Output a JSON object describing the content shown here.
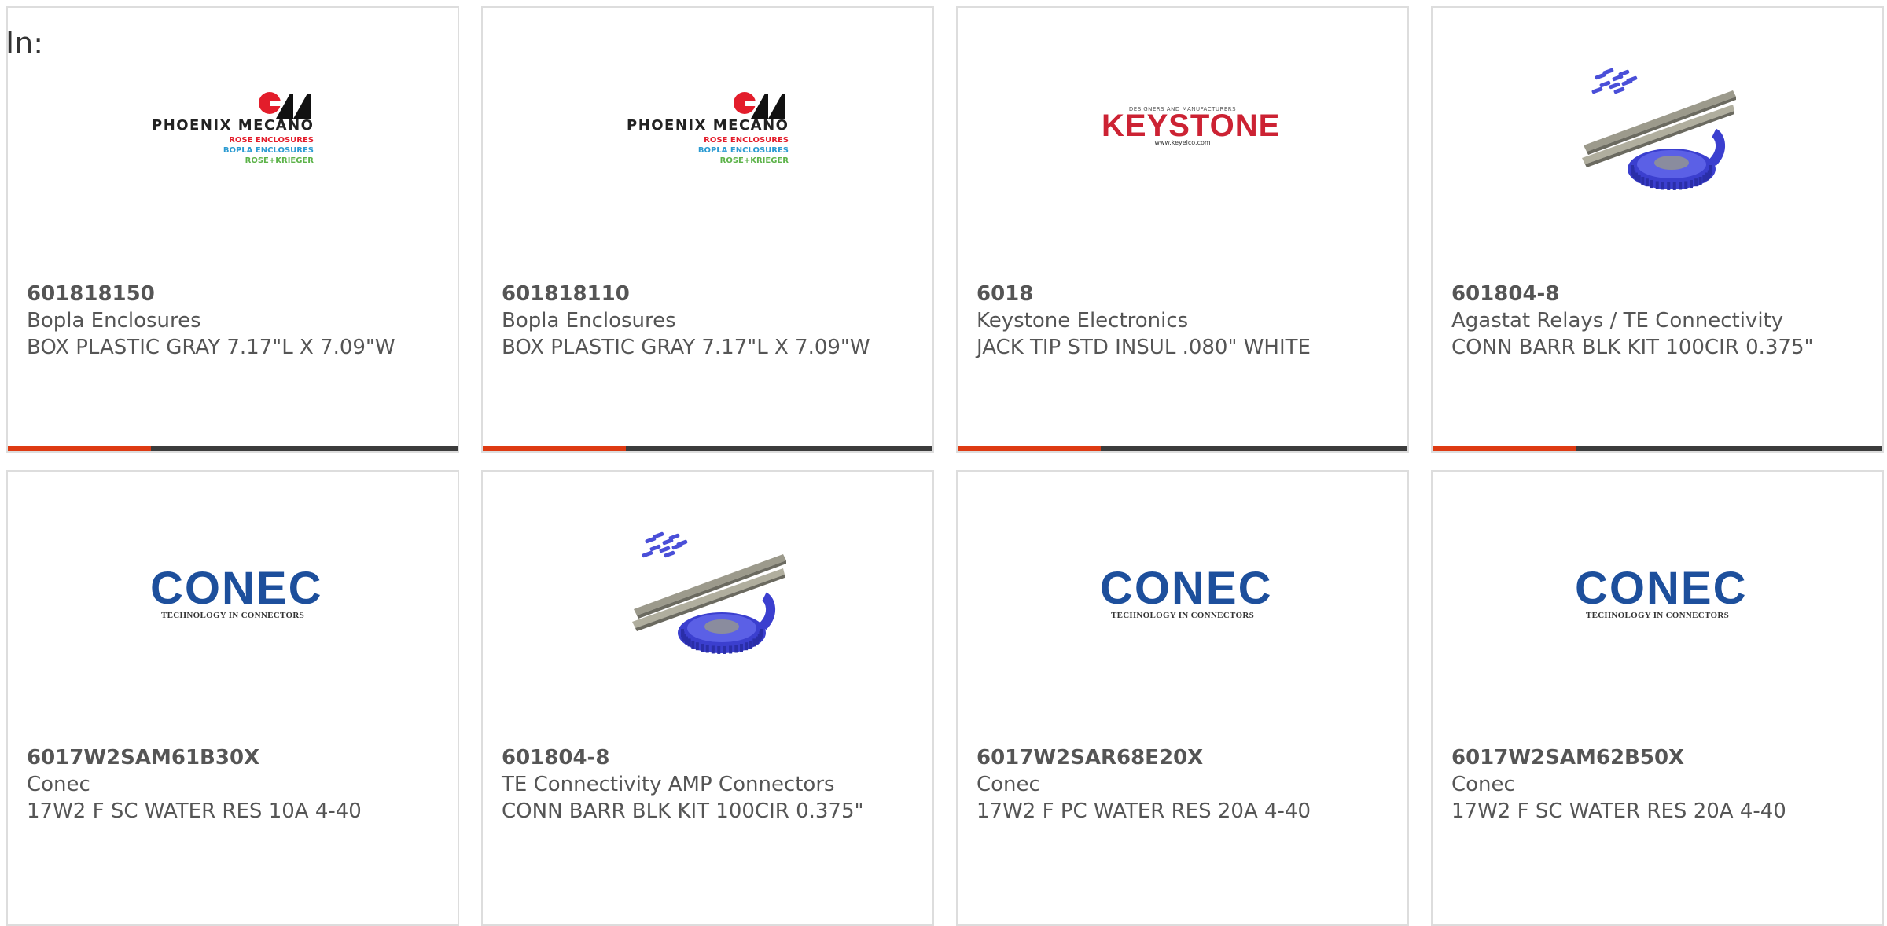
{
  "header": {
    "in_label": "In:"
  },
  "colors": {
    "accent": "#de3a12",
    "bar_dark": "#3c3c3c",
    "text": "#555555"
  },
  "brands": {
    "phoenix": {
      "name": "PHOENIX MECANO",
      "line1": "ROSE ENCLOSURES",
      "line2": "BOPLA ENCLOSURES",
      "line3": "ROSE+KRIEGER",
      "colors": [
        "#e31d2b",
        "#2a9ad1",
        "#5db34a"
      ]
    },
    "keystone": {
      "top": "DESIGNERS AND MANUFACTURERS",
      "name": "KEYSTONE",
      "url": "www.keyelco.com",
      "color": "#cc2233"
    },
    "conec": {
      "name": "CONEC",
      "tagline": "TECHNOLOGY IN CONNECTORS",
      "color": "#1d4f9c"
    }
  },
  "products": [
    {
      "part": "601818150",
      "manufacturer": "Bopla Enclosures",
      "description": "BOX PLASTIC GRAY 7.17\"L X 7.09\"W",
      "logo": "phoenix"
    },
    {
      "part": "601818110",
      "manufacturer": "Bopla Enclosures",
      "description": "BOX PLASTIC GRAY 7.17\"L X 7.09\"W",
      "logo": "phoenix"
    },
    {
      "part": "6018",
      "manufacturer": "Keystone Electronics",
      "description": "JACK TIP STD INSUL .080\" WHITE",
      "logo": "keystone"
    },
    {
      "part": "601804-8",
      "manufacturer": "Agastat Relays / TE Connectivity",
      "description": "CONN BARR BLK KIT 100CIR 0.375\"",
      "logo": "product-photo"
    },
    {
      "part": "6017W2SAM61B30X",
      "manufacturer": "Conec",
      "description": "17W2 F SC WATER RES 10A 4-40",
      "logo": "conec"
    },
    {
      "part": "601804-8",
      "manufacturer": "TE Connectivity AMP Connectors",
      "description": "CONN BARR BLK KIT 100CIR 0.375\"",
      "logo": "product-photo"
    },
    {
      "part": "6017W2SAR68E20X",
      "manufacturer": "Conec",
      "description": "17W2 F PC WATER RES 20A 4-40",
      "logo": "conec"
    },
    {
      "part": "6017W2SAM62B50X",
      "manufacturer": "Conec",
      "description": "17W2 F SC WATER RES 20A 4-40",
      "logo": "conec"
    }
  ]
}
